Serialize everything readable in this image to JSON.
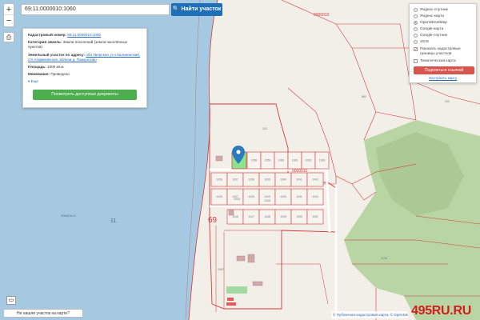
{
  "search": {
    "value": "69:11:0000010:1060",
    "button_label": "Найти участок",
    "button_icon": "search-icon"
  },
  "zoom": {
    "plus": "+",
    "minus": "−"
  },
  "info_card": {
    "cadastral_label": "Кадастровый номер:",
    "cadastral_value": "69:11:0000010:1060",
    "category_label": "Категория земель:",
    "category_value": "Земли поселений (земли населённых пунктов)",
    "address_label": "Земельный участок по адресу:",
    "address_value": "обл Тверская, р-н Калининский, с/п Алфимовское, вблизи д. Панкратово",
    "area_label": "Площадь:",
    "area_value": "1000 кв.м.",
    "survey_label": "Межевание:",
    "survey_value": "Проведено",
    "more_label": "Еще",
    "docs_button": "Посмотреть доступные документы"
  },
  "layers_panel": {
    "base_layers": [
      {
        "label": "Яндекс-спутник",
        "selected": false
      },
      {
        "label": "Яндекс-карта",
        "selected": false
      },
      {
        "label": "OpenStreetMap",
        "selected": true
      },
      {
        "label": "Google-карта",
        "selected": false
      },
      {
        "label": "Google-спутник",
        "selected": false
      },
      {
        "label": "2GIS",
        "selected": false
      }
    ],
    "overlay_boundaries": "Показать кадастровые границы участков",
    "overlay_boundaries_checked": true,
    "overlay_thematic": "Тематическая карта",
    "overlay_thematic_checked": false,
    "share_button": "Поделиться ссылкой",
    "settings_link": "Настроить карту"
  },
  "map_labels": {
    "quarter_top": "0000010",
    "quarter_mid": "0000010",
    "region_number": "69",
    "district_number": "11",
    "district_code_small": "0000010:1",
    "parcels_row1": [
      "1058",
      "1059",
      "1060",
      "1061",
      "1062",
      "1063",
      "1064",
      "1065"
    ],
    "parcels_row2": [
      "1036",
      "1037",
      "1038",
      "1039",
      "1040",
      "1041",
      "1042"
    ],
    "parcels_row3": [
      "1026",
      "1027",
      "1028",
      "1029",
      "1030",
      "1031",
      "1032"
    ],
    "parcels_row4": [
      "1046",
      "1047",
      "1048",
      "1049",
      "1050",
      "1051"
    ],
    "misc": [
      "115",
      "862",
      "240",
      "1148",
      "1067",
      "1035",
      "1033"
    ]
  },
  "notfound_button": "Не нашли участок на карте?",
  "attribution": "© Публичная кадастровая карта, © OpenStreetMap",
  "watermark": "495RU.RU",
  "colors": {
    "river": "#a6c9e2",
    "land": "#f2efe9",
    "forest": "#b9d5a4",
    "parcel_border": "#d43a3a",
    "selected_parcel": "#8ee38e",
    "marker": "#2a7bbd",
    "accent_blue": "#1e6fb7",
    "share_red": "#d9534f",
    "docs_green": "#4cae4c"
  }
}
